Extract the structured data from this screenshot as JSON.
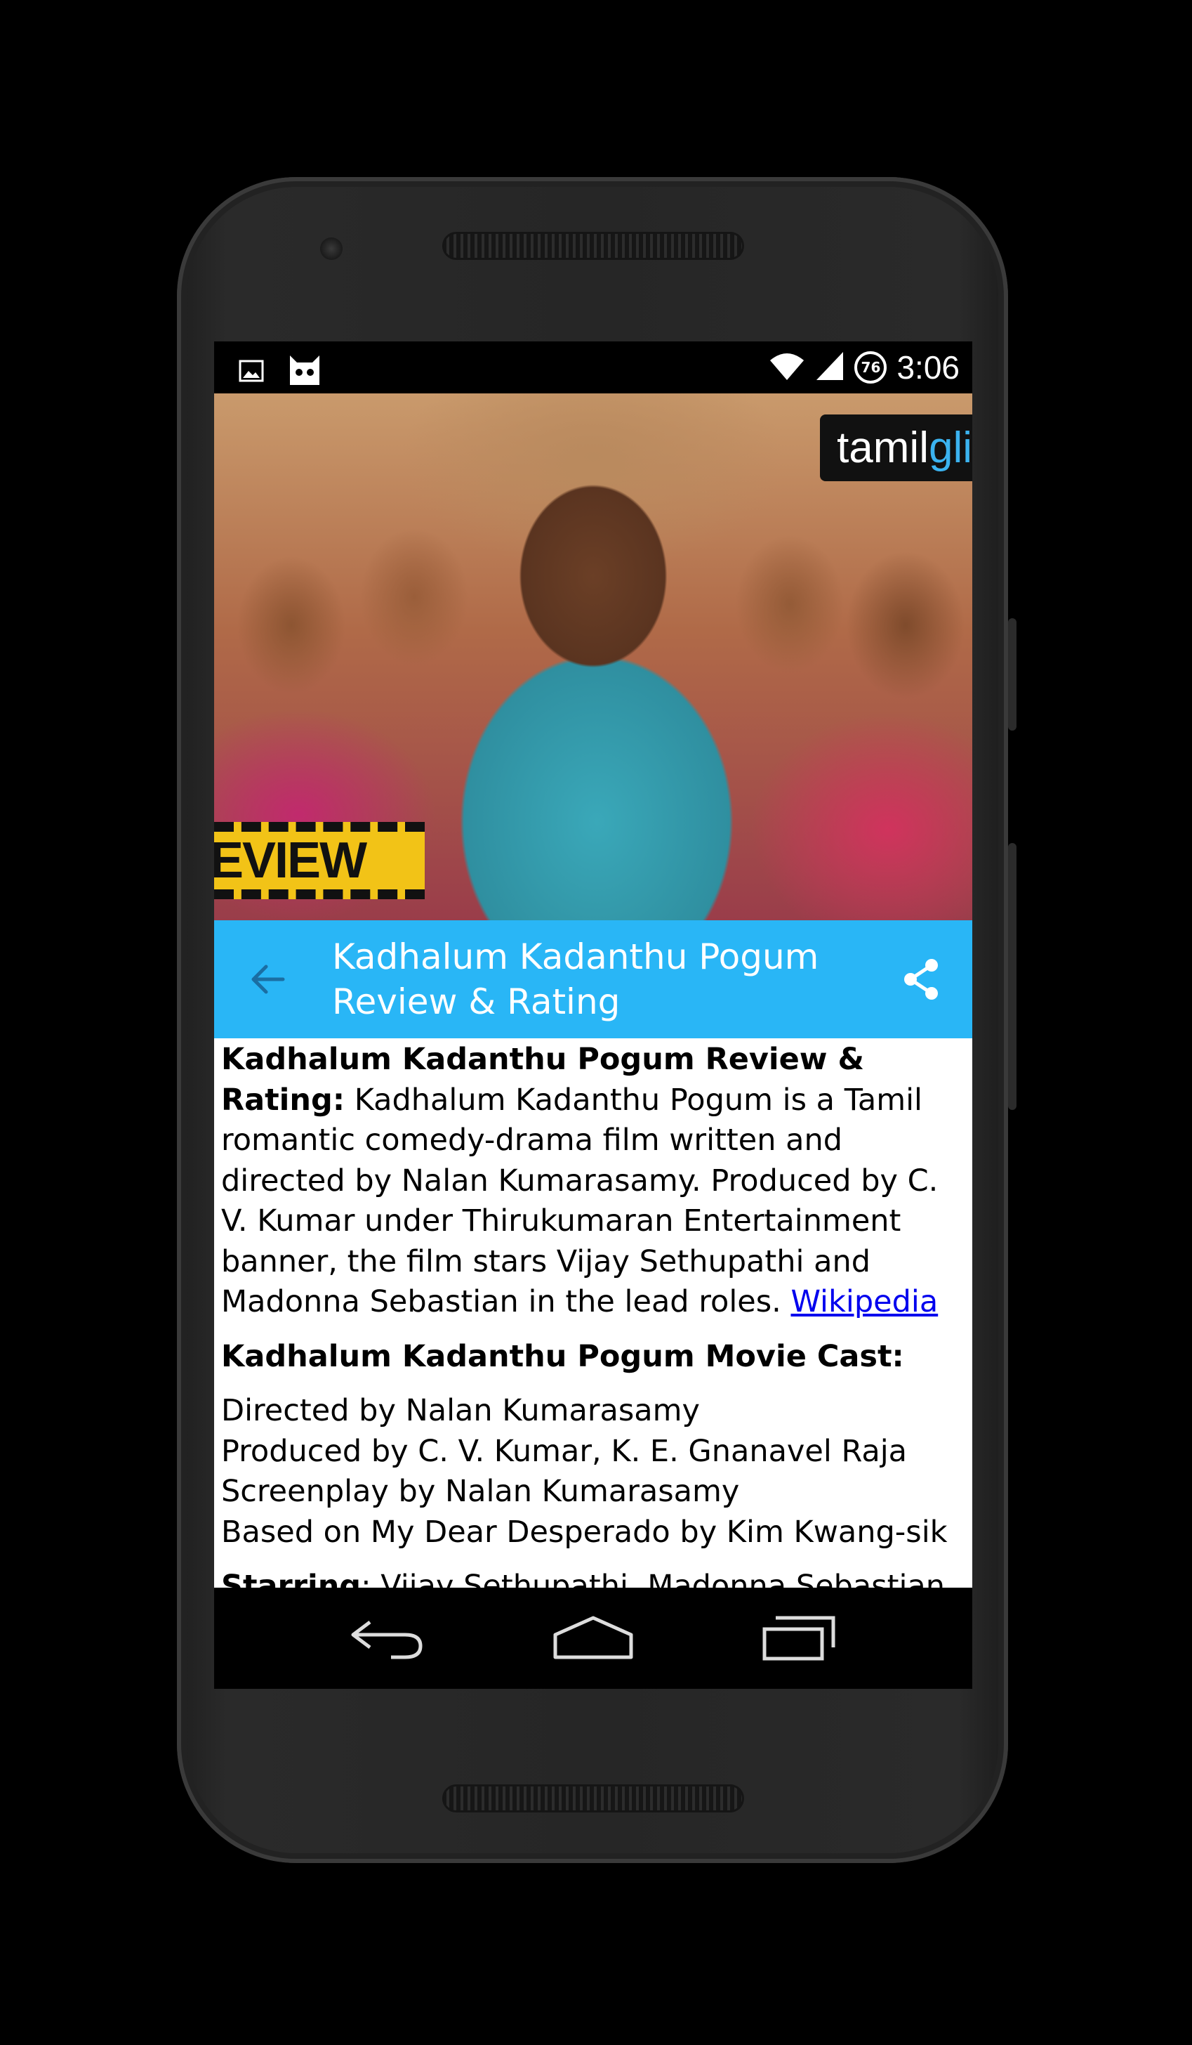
{
  "statusbar": {
    "time": "3:06",
    "battery_level": "76",
    "icons": [
      "image-icon",
      "cyanogen-bot-icon",
      "wifi-icon",
      "signal-icon"
    ]
  },
  "hero": {
    "logo_text_a": "tamil",
    "logo_text_b": "gli",
    "banner_text": "EVIEW"
  },
  "toolbar": {
    "title": "Kadhalum Kadanthu Pogum Review & Rating",
    "accent_color": "#29b6f6"
  },
  "article": {
    "intro_heading": "Kadhalum Kadanthu Pogum Review & Rating:",
    "intro_body": "Kadhalum Kadanthu Pogum is a Tamil romantic comedy-drama film written and directed by Nalan Kumarasamy. Produced by C. V. Kumar under Thirukumaran Entertainment banner, the film stars Vijay Sethupathi and Madonna Sebastian in the lead roles.",
    "source_link": "Wikipedia",
    "cast_heading": "Kadhalum Kadanthu Pogum Movie Cast:",
    "cast_lines": [
      "Directed by Nalan Kumarasamy",
      "Produced by C. V. Kumar, K. E. Gnanavel Raja",
      "Screenplay by Nalan Kumarasamy",
      "Based on My Dear Desperado by Kim Kwang-sik"
    ],
    "starring_label": "Starring",
    "starring_value": ": Vijay Sethupathi, Madonna Sebastian &"
  },
  "navbar": {
    "buttons": [
      "back-nav-icon",
      "home-icon",
      "recents-icon"
    ]
  }
}
